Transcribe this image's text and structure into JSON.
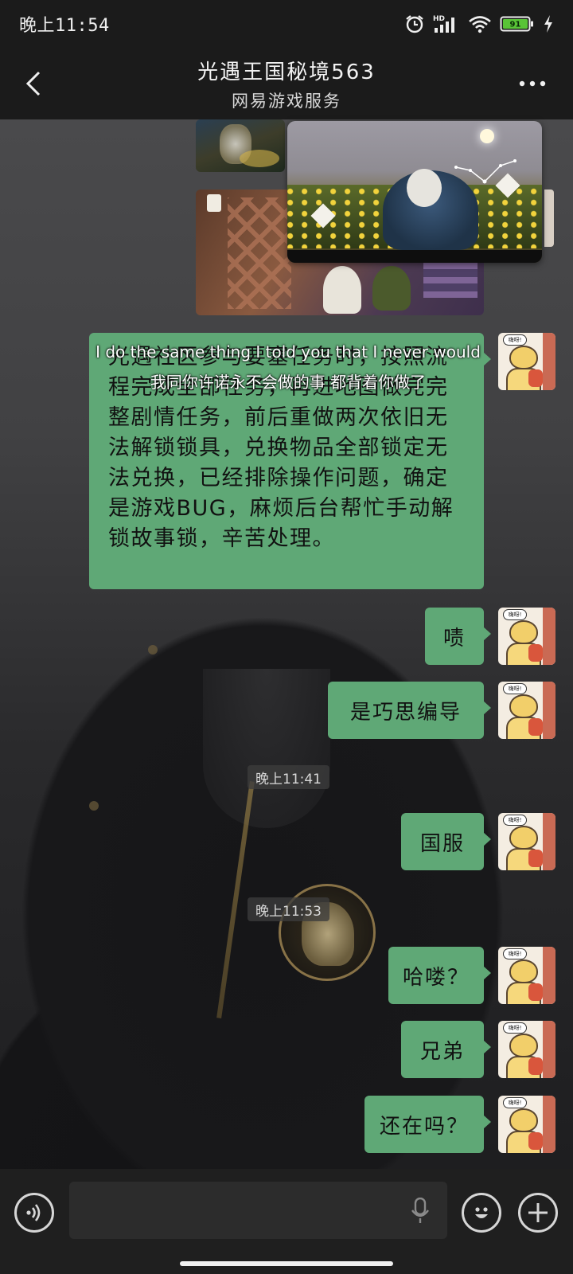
{
  "status_bar": {
    "time": "晚上11:54",
    "icons": [
      "alarm-icon",
      "hd-signal-icon",
      "wifi-icon",
      "battery-icon",
      "charging-icon"
    ],
    "network_badge": "HD",
    "battery_level": "91"
  },
  "header": {
    "title": "光遇王国秘境563",
    "subtitle": "网易游戏服务",
    "back_icon": "chevron-left-icon",
    "more_icon": "more-dots-icon"
  },
  "overlay_text": {
    "line1": "I do the same thing I told you that I never would",
    "line2": "我同你许诺永不会做的事 都背着你做了"
  },
  "messages": {
    "long": "光遇社区参与要塞任务时，按照流程完成全部任务，再进地图做完完整剧情任务，前后重做两次依旧无法解锁锁具，兑换物品全部锁定无法兑换，已经排除操作问题，确定是游戏BUG，麻烦后台帮忙手动解锁故事锁，辛苦处理。",
    "m1": "啧",
    "m2": "是巧思编导",
    "time1": "晚上11:41",
    "m3": "国服",
    "time2": "晚上11:53",
    "m4": "哈喽？",
    "m5": "兄弟",
    "m6": "还在吗？"
  },
  "avatar": {
    "sticker_text": "嗨呀!"
  },
  "input_bar": {
    "placeholder": "",
    "value": "",
    "voice_icon": "voice-icon",
    "mic_icon": "mic-icon",
    "emoji_icon": "emoji-icon",
    "plus_icon": "plus-icon"
  },
  "colors": {
    "bubble_green": "#5fa876",
    "bar_background": "#1b1b1b",
    "battery_green": "#59c437"
  }
}
